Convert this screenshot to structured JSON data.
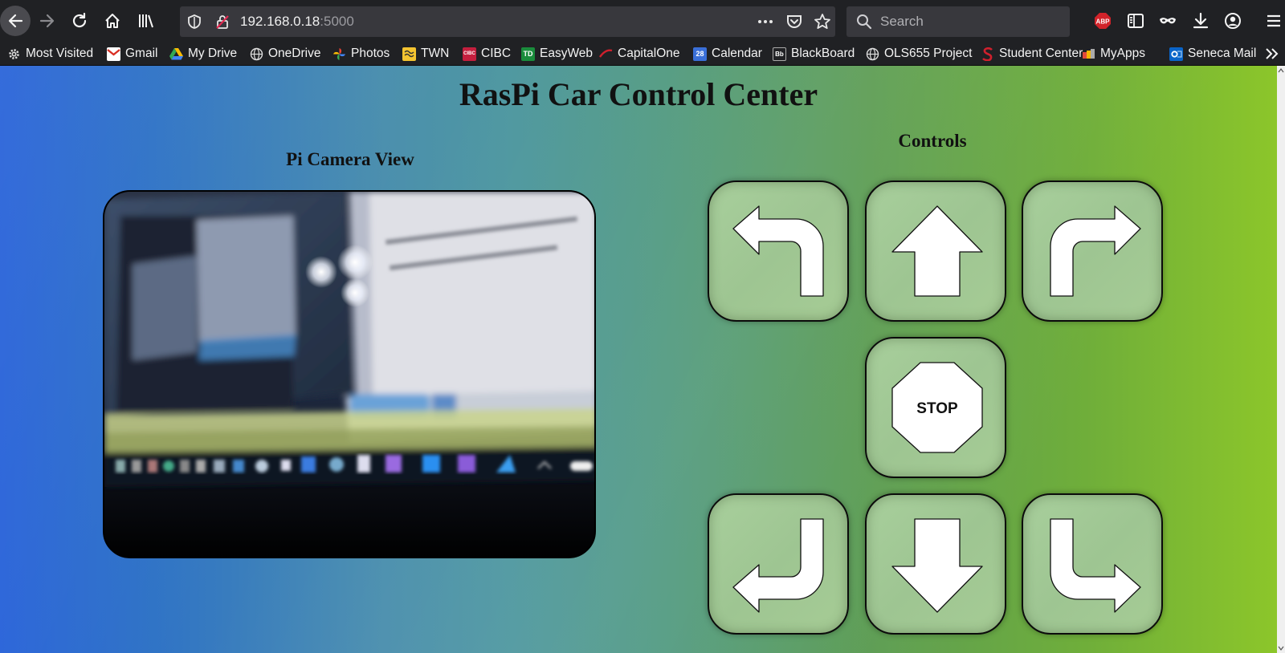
{
  "browser": {
    "url_host": "192.168.0.18",
    "url_port": ":5000",
    "search_placeholder": "Search",
    "adblock_badge": "ABP",
    "bookmarks": [
      {
        "label": "Most Visited",
        "icon": "gear-icon"
      },
      {
        "label": "Gmail",
        "icon": "gmail-icon"
      },
      {
        "label": "My Drive",
        "icon": "drive-icon"
      },
      {
        "label": "OneDrive",
        "icon": "globe-icon"
      },
      {
        "label": "Photos",
        "icon": "photos-icon"
      },
      {
        "label": "TWN",
        "icon": "twn-icon"
      },
      {
        "label": "CIBC",
        "icon": "cibc-icon"
      },
      {
        "label": "EasyWeb",
        "icon": "td-icon"
      },
      {
        "label": "CapitalOne",
        "icon": "capitalone-icon"
      },
      {
        "label": "Calendar",
        "icon": "calendar-icon"
      },
      {
        "label": "BlackBoard",
        "icon": "blackboard-icon"
      },
      {
        "label": "OLS655 Project",
        "icon": "globe-icon"
      },
      {
        "label": "Student Center",
        "icon": "seneca-icon"
      },
      {
        "label": "MyApps",
        "icon": "myapps-icon"
      },
      {
        "label": "Seneca Mail",
        "icon": "outlook-icon"
      }
    ],
    "bookmark_icon_text": {
      "cibc": "CIBC",
      "td": "TD",
      "calendar": "28",
      "blackboard": "Bb"
    }
  },
  "page": {
    "title": "RasPi Car Control Center",
    "camera_heading": "Pi Camera View",
    "controls_heading": "Controls",
    "stop_label": "STOP"
  },
  "colors": {
    "gradient_left": "#2a64d9",
    "gradient_right": "#8cc62a",
    "button_fill": "#a3ca96"
  }
}
